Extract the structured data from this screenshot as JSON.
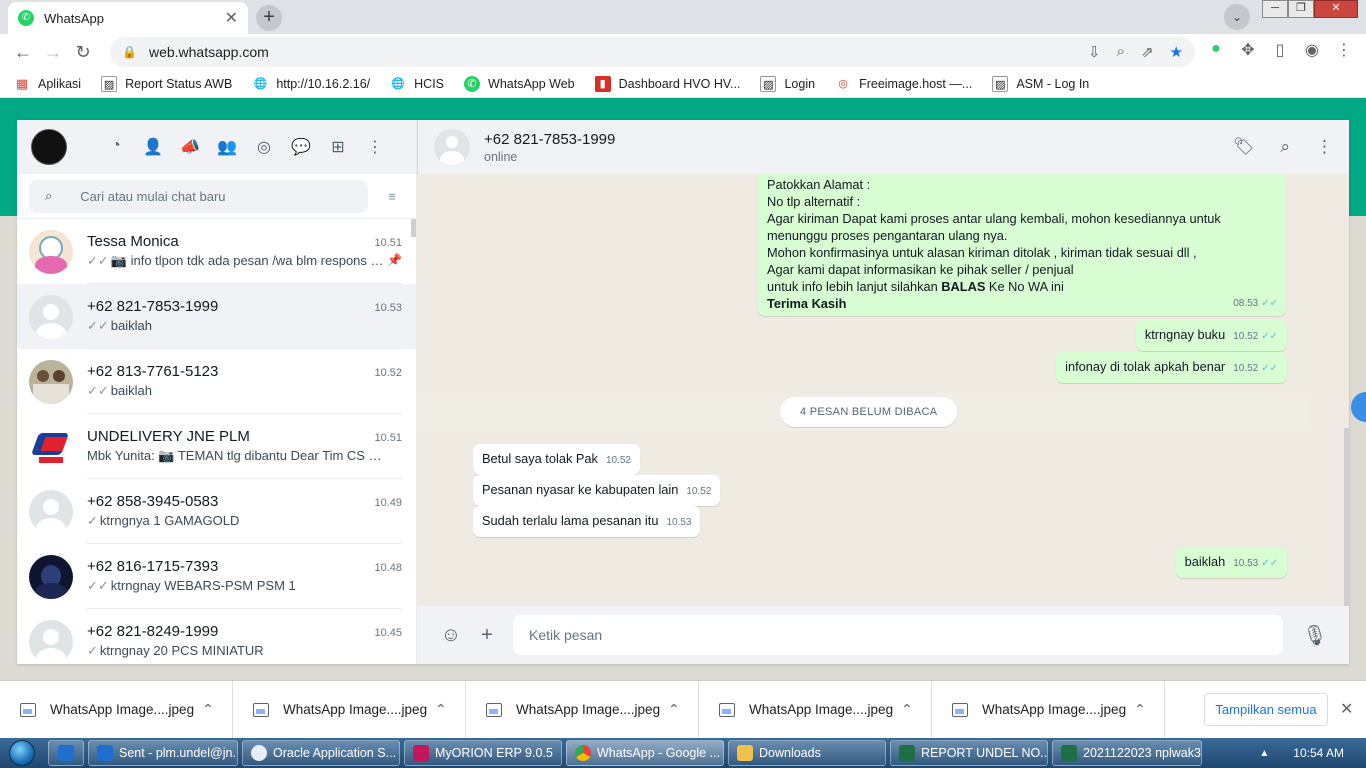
{
  "browser": {
    "tab_title": "WhatsApp",
    "url": "web.whatsapp.com",
    "bookmarks": [
      {
        "label": "Aplikasi",
        "icon": "apps-grid-icon"
      },
      {
        "label": "Report Status AWB",
        "icon": "page-icon"
      },
      {
        "label": "http://10.16.2.16/",
        "icon": "globe-icon"
      },
      {
        "label": "HCIS",
        "icon": "globe-icon"
      },
      {
        "label": "WhatsApp Web",
        "icon": "whatsapp-icon"
      },
      {
        "label": "Dashboard HVO HV...",
        "icon": "dashboard-icon"
      },
      {
        "label": "Login",
        "icon": "page-icon"
      },
      {
        "label": "Freeimage.host —...",
        "icon": "freeimage-icon"
      },
      {
        "label": "ASM - Log In",
        "icon": "page-icon"
      }
    ]
  },
  "sidebar": {
    "search_placeholder": "Cari atau mulai chat baru",
    "chats": [
      {
        "name": "Tessa Monica",
        "time": "10.51",
        "tick": "✓✓",
        "preview": "📷 info tlpon tdk ada pesan /wa blm respons CS...",
        "pinned": true,
        "avatar": "photo"
      },
      {
        "name": "+62 821-7853-1999",
        "time": "10.53",
        "tick": "✓✓",
        "preview": "baiklah",
        "active": true,
        "avatar": "default"
      },
      {
        "name": "+62 813-7761-5123",
        "time": "10.52",
        "tick": "✓✓",
        "preview": "baiklah",
        "avatar": "photo"
      },
      {
        "name": "UNDELIVERY JNE PLM",
        "time": "10.51",
        "tick": "",
        "preview": "Mbk Yunita: 📷 TEMAN tlg dibantu  Dear Tim CS dan ...",
        "avatar": "logo"
      },
      {
        "name": "+62 858-3945-0583",
        "time": "10.49",
        "tick": "✓",
        "preview": "ktrngnya 1 GAMAGOLD",
        "avatar": "default"
      },
      {
        "name": "+62 816-1715-7393",
        "time": "10.48",
        "tick": "✓✓",
        "preview": "ktrngnay   WEBARS-PSM  PSM  1",
        "avatar": "dark"
      },
      {
        "name": "+62 821-8249-1999",
        "time": "10.45",
        "tick": "✓",
        "preview": "ktrngnay 20 PCS MINIATUR",
        "avatar": "default"
      }
    ]
  },
  "conversation": {
    "contact": "+62 821-7853-1999",
    "status": "online",
    "big_message": {
      "lines": [
        "Patokkan Alamat :",
        "No tlp alternatif :",
        "Agar kiriman Dapat kami proses antar ulang kembali, mohon kesediannya untuk",
        "menunggu proses pengantaran ulang nya.",
        "Mohon konfirmasinya untuk alasan kiriman ditolak , kiriman tidak sesuai dll ,",
        "Agar kami dapat informasikan ke pihak seller / penjual"
      ],
      "last_prefix": "untuk info lebih lanjut silahkan ",
      "last_bold": "BALAS",
      "last_suffix": " Ke No WA ini",
      "closing": "Terima Kasih",
      "time": "08.53"
    },
    "outgoing_1": {
      "text": "ktrngnay buku",
      "time": "10.52"
    },
    "outgoing_2": {
      "text": "infonay di tolak apkah benar",
      "time": "10.52"
    },
    "unread_label": "4 PESAN BELUM DIBACA",
    "incoming": [
      {
        "text": "Betul saya tolak Pak",
        "time": "10.52"
      },
      {
        "text": "Pesanan nyasar ke kabupaten lain",
        "time": "10.52"
      },
      {
        "text": "Sudah terlalu lama pesanan itu",
        "time": "10.53"
      }
    ],
    "outgoing_3": {
      "text": "baiklah",
      "time": "10.53"
    },
    "compose_placeholder": "Ketik pesan"
  },
  "downloads": {
    "items": [
      "WhatsApp Image....jpeg",
      "WhatsApp Image....jpeg",
      "WhatsApp Image....jpeg",
      "WhatsApp Image....jpeg",
      "WhatsApp Image....jpeg"
    ],
    "show_all": "Tampilkan semua"
  },
  "taskbar": {
    "items": [
      {
        "label": "Sent - plm.undel@jn...",
        "color": "#1e6fd0"
      },
      {
        "label": "Oracle Application S...",
        "color": "#e8eef7"
      },
      {
        "label": "MyORION ERP 9.0.5",
        "color": "#c2185b"
      },
      {
        "label": "WhatsApp - Google ...",
        "color": "#f4b400"
      },
      {
        "label": "Downloads",
        "color": "#f0c24b"
      },
      {
        "label": "REPORT UNDEL NO...",
        "color": "#1d7044"
      },
      {
        "label": "2021122023 nplwak3...",
        "color": "#1d7044"
      }
    ],
    "clock": "10:54 AM"
  }
}
